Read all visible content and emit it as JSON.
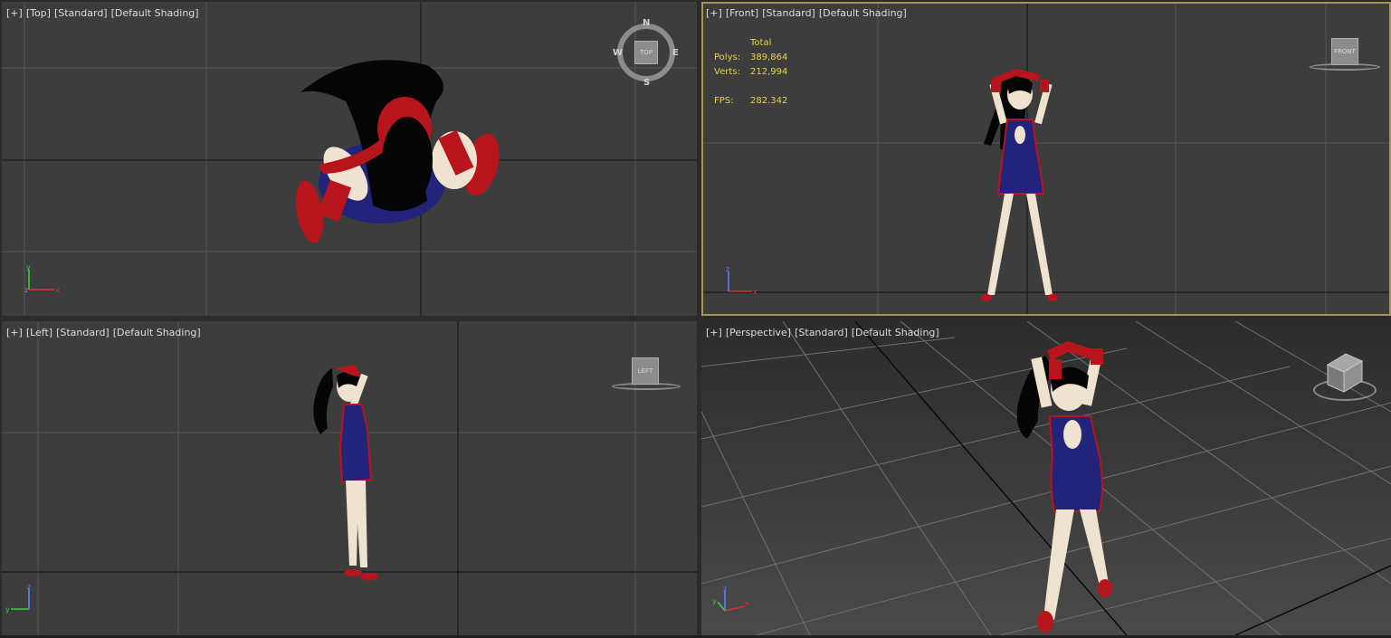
{
  "viewports": {
    "top": {
      "plus": "[+]",
      "view": "[Top]",
      "mode": "[Standard]",
      "shading": "[Default Shading]"
    },
    "front": {
      "plus": "[+]",
      "view": "[Front]",
      "mode": "[Standard]",
      "shading": "[Default Shading]"
    },
    "left": {
      "plus": "[+]",
      "view": "[Left]",
      "mode": "[Standard]",
      "shading": "[Default Shading]"
    },
    "persp": {
      "plus": "[+]",
      "view": "[Perspective]",
      "mode": "[Standard]",
      "shading": "[Default Shading]"
    }
  },
  "stats": {
    "total_label": "Total",
    "polys_label": "Polys:",
    "polys": "389,864",
    "verts_label": "Verts:",
    "verts": "212,994",
    "fps_label": "FPS:",
    "fps": "282.342"
  },
  "viewcube": {
    "top_label": "TOP",
    "front_label": "FRONT",
    "left_label": "LEFT",
    "n": "N",
    "s": "S",
    "e": "E",
    "w": "W"
  },
  "axes": {
    "x": "x",
    "y": "y",
    "z": "z"
  },
  "colors": {
    "active_border": "#a89254",
    "stats_text": "#e6d24a",
    "dress": "#22237a",
    "accent_red": "#b8141c",
    "skin": "#efe2cf"
  }
}
